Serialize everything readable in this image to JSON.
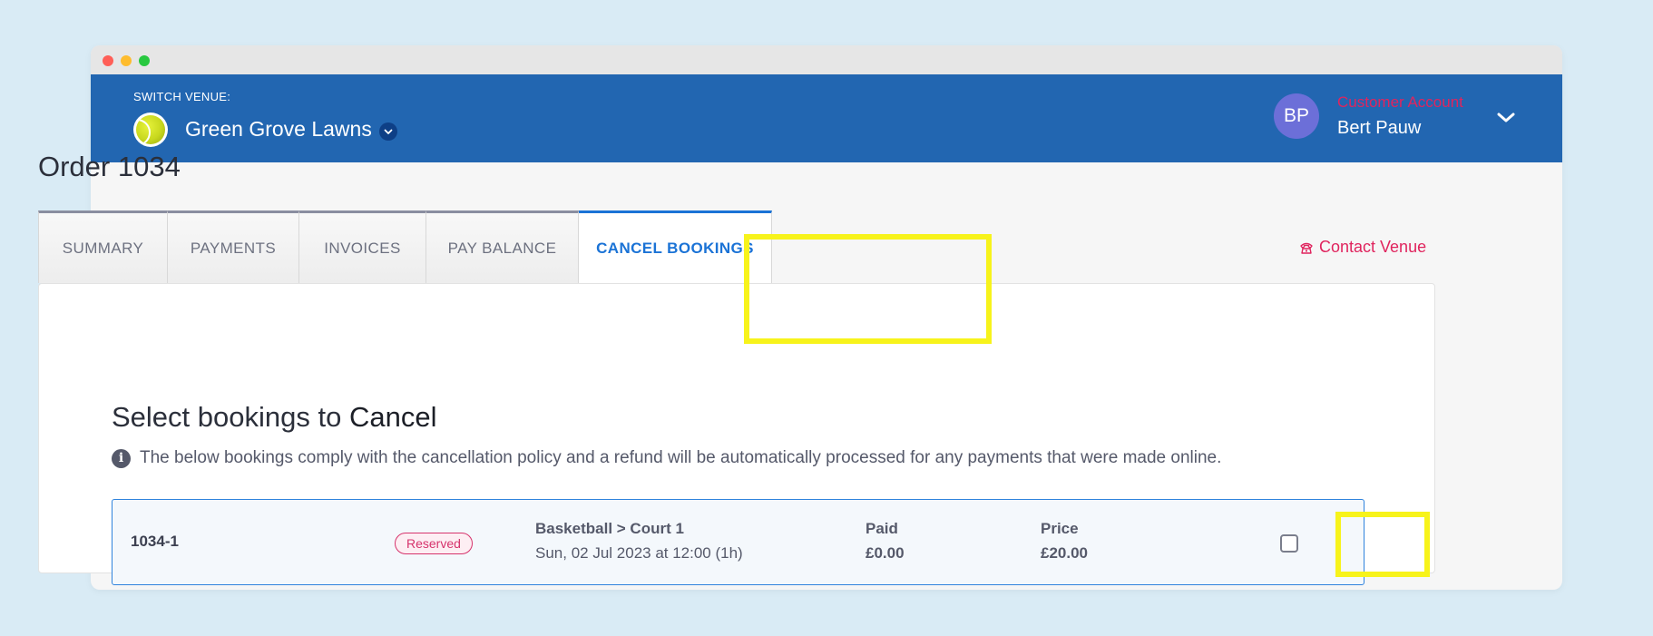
{
  "header": {
    "switch_label": "SWITCH VENUE:",
    "venue_name": "Green Grove Lawns",
    "avatar_initials": "BP",
    "account_type": "Customer Account",
    "account_name": "Bert Pauw"
  },
  "page": {
    "title": "Order 1034"
  },
  "tabs": [
    {
      "label": "SUMMARY",
      "active": false
    },
    {
      "label": "PAYMENTS",
      "active": false
    },
    {
      "label": "INVOICES",
      "active": false
    },
    {
      "label": "PAY BALANCE",
      "active": false
    },
    {
      "label": "CANCEL BOOKINGS",
      "active": true
    }
  ],
  "contact_label": "Contact Venue",
  "cancel_section": {
    "heading_prefix": "Select bookings to",
    "heading_emphasis": "Cancel",
    "info_text": "The below bookings comply with the cancellation policy and a refund will be automatically processed for any payments that were made online."
  },
  "bookings": [
    {
      "id": "1034-1",
      "status": "Reserved",
      "activity": "Basketball > Court 1",
      "datetime": "Sun, 02 Jul 2023 at 12:00 (1h)",
      "paid_label": "Paid",
      "paid_value": "£0.00",
      "price_label": "Price",
      "price_value": "£20.00",
      "selected": false
    }
  ],
  "colors": {
    "header_bg": "#2266b1",
    "accent_blue": "#1b73d6",
    "accent_pink": "#e0245e",
    "highlight": "#f7f31b",
    "page_bg": "#d9ebf5"
  }
}
